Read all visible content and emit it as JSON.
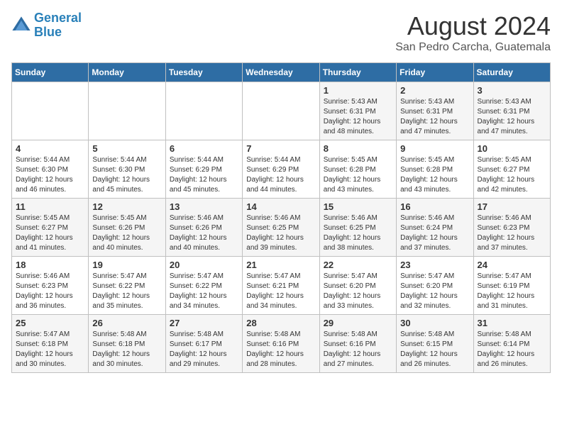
{
  "logo": {
    "line1": "General",
    "line2": "Blue"
  },
  "title": "August 2024",
  "subtitle": "San Pedro Carcha, Guatemala",
  "days_of_week": [
    "Sunday",
    "Monday",
    "Tuesday",
    "Wednesday",
    "Thursday",
    "Friday",
    "Saturday"
  ],
  "weeks": [
    [
      {
        "day": "",
        "content": ""
      },
      {
        "day": "",
        "content": ""
      },
      {
        "day": "",
        "content": ""
      },
      {
        "day": "",
        "content": ""
      },
      {
        "day": "1",
        "content": "Sunrise: 5:43 AM\nSunset: 6:31 PM\nDaylight: 12 hours and 48 minutes."
      },
      {
        "day": "2",
        "content": "Sunrise: 5:43 AM\nSunset: 6:31 PM\nDaylight: 12 hours and 47 minutes."
      },
      {
        "day": "3",
        "content": "Sunrise: 5:43 AM\nSunset: 6:31 PM\nDaylight: 12 hours and 47 minutes."
      }
    ],
    [
      {
        "day": "4",
        "content": "Sunrise: 5:44 AM\nSunset: 6:30 PM\nDaylight: 12 hours and 46 minutes."
      },
      {
        "day": "5",
        "content": "Sunrise: 5:44 AM\nSunset: 6:30 PM\nDaylight: 12 hours and 45 minutes."
      },
      {
        "day": "6",
        "content": "Sunrise: 5:44 AM\nSunset: 6:29 PM\nDaylight: 12 hours and 45 minutes."
      },
      {
        "day": "7",
        "content": "Sunrise: 5:44 AM\nSunset: 6:29 PM\nDaylight: 12 hours and 44 minutes."
      },
      {
        "day": "8",
        "content": "Sunrise: 5:45 AM\nSunset: 6:28 PM\nDaylight: 12 hours and 43 minutes."
      },
      {
        "day": "9",
        "content": "Sunrise: 5:45 AM\nSunset: 6:28 PM\nDaylight: 12 hours and 43 minutes."
      },
      {
        "day": "10",
        "content": "Sunrise: 5:45 AM\nSunset: 6:27 PM\nDaylight: 12 hours and 42 minutes."
      }
    ],
    [
      {
        "day": "11",
        "content": "Sunrise: 5:45 AM\nSunset: 6:27 PM\nDaylight: 12 hours and 41 minutes."
      },
      {
        "day": "12",
        "content": "Sunrise: 5:45 AM\nSunset: 6:26 PM\nDaylight: 12 hours and 40 minutes."
      },
      {
        "day": "13",
        "content": "Sunrise: 5:46 AM\nSunset: 6:26 PM\nDaylight: 12 hours and 40 minutes."
      },
      {
        "day": "14",
        "content": "Sunrise: 5:46 AM\nSunset: 6:25 PM\nDaylight: 12 hours and 39 minutes."
      },
      {
        "day": "15",
        "content": "Sunrise: 5:46 AM\nSunset: 6:25 PM\nDaylight: 12 hours and 38 minutes."
      },
      {
        "day": "16",
        "content": "Sunrise: 5:46 AM\nSunset: 6:24 PM\nDaylight: 12 hours and 37 minutes."
      },
      {
        "day": "17",
        "content": "Sunrise: 5:46 AM\nSunset: 6:23 PM\nDaylight: 12 hours and 37 minutes."
      }
    ],
    [
      {
        "day": "18",
        "content": "Sunrise: 5:46 AM\nSunset: 6:23 PM\nDaylight: 12 hours and 36 minutes."
      },
      {
        "day": "19",
        "content": "Sunrise: 5:47 AM\nSunset: 6:22 PM\nDaylight: 12 hours and 35 minutes."
      },
      {
        "day": "20",
        "content": "Sunrise: 5:47 AM\nSunset: 6:22 PM\nDaylight: 12 hours and 34 minutes."
      },
      {
        "day": "21",
        "content": "Sunrise: 5:47 AM\nSunset: 6:21 PM\nDaylight: 12 hours and 34 minutes."
      },
      {
        "day": "22",
        "content": "Sunrise: 5:47 AM\nSunset: 6:20 PM\nDaylight: 12 hours and 33 minutes."
      },
      {
        "day": "23",
        "content": "Sunrise: 5:47 AM\nSunset: 6:20 PM\nDaylight: 12 hours and 32 minutes."
      },
      {
        "day": "24",
        "content": "Sunrise: 5:47 AM\nSunset: 6:19 PM\nDaylight: 12 hours and 31 minutes."
      }
    ],
    [
      {
        "day": "25",
        "content": "Sunrise: 5:47 AM\nSunset: 6:18 PM\nDaylight: 12 hours and 30 minutes."
      },
      {
        "day": "26",
        "content": "Sunrise: 5:48 AM\nSunset: 6:18 PM\nDaylight: 12 hours and 30 minutes."
      },
      {
        "day": "27",
        "content": "Sunrise: 5:48 AM\nSunset: 6:17 PM\nDaylight: 12 hours and 29 minutes."
      },
      {
        "day": "28",
        "content": "Sunrise: 5:48 AM\nSunset: 6:16 PM\nDaylight: 12 hours and 28 minutes."
      },
      {
        "day": "29",
        "content": "Sunrise: 5:48 AM\nSunset: 6:16 PM\nDaylight: 12 hours and 27 minutes."
      },
      {
        "day": "30",
        "content": "Sunrise: 5:48 AM\nSunset: 6:15 PM\nDaylight: 12 hours and 26 minutes."
      },
      {
        "day": "31",
        "content": "Sunrise: 5:48 AM\nSunset: 6:14 PM\nDaylight: 12 hours and 26 minutes."
      }
    ]
  ]
}
